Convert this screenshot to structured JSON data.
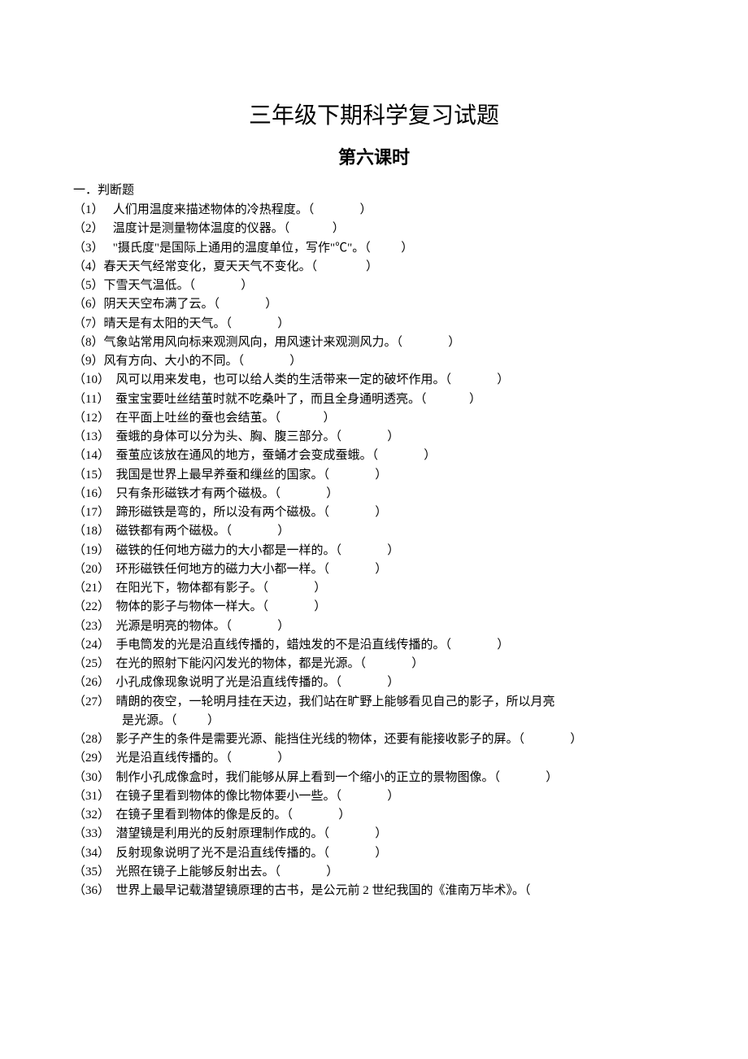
{
  "title": "三年级下期科学复习试题",
  "subtitle": "第六课时",
  "section_header": "一．判断题",
  "items": [
    {
      "num": "（1）",
      "gap": "   ",
      "text": "人们用温度来描述物体的冷热程度。",
      "paren": "（               ）"
    },
    {
      "num": "（2）",
      "gap": "   ",
      "text": "温度计是测量物体温度的仪器。",
      "paren": "（              ）"
    },
    {
      "num": "（3）",
      "gap": "   ",
      "text": "\"摄氏度\"是国际上通用的温度单位，写作\"℃\"。",
      "paren": "（          ）"
    },
    {
      "num": "（4）",
      "gap": "",
      "text": "春天天气经常变化，夏天天气不变化。",
      "paren": "（                ）"
    },
    {
      "num": "（5）",
      "gap": "",
      "text": "下雪天气温低。",
      "paren": "（               ）"
    },
    {
      "num": "（6）",
      "gap": "",
      "text": "阴天天空布满了云。",
      "paren": "（               ）"
    },
    {
      "num": "（7）",
      "gap": "",
      "text": "晴天是有太阳的天气。",
      "paren": "（               ）"
    },
    {
      "num": "（8）",
      "gap": "",
      "text": "气象站常用风向标来观测风向，用风速计来观测风力。",
      "paren": "（               ）"
    },
    {
      "num": "（9）",
      "gap": "",
      "text": "风有方向、大小的不同。",
      "paren": "（               ）"
    },
    {
      "num": "（10）",
      "gap": "  ",
      "text": "风可以用来发电，也可以给人类的生活带来一定的破坏作用。",
      "paren": "（               ）"
    },
    {
      "num": "（11）",
      "gap": "  ",
      "text": "蚕宝宝要吐丝结茧时就不吃桑叶了，而且全身通明透亮。",
      "paren": "（              ）"
    },
    {
      "num": "（12）",
      "gap": "  ",
      "text": "在平面上吐丝的蚕也会结茧。",
      "paren": "（              ）"
    },
    {
      "num": "（13）",
      "gap": "  ",
      "text": "蚕蛾的身体可以分为头、胸、腹三部分。",
      "paren": "（               ）"
    },
    {
      "num": "（14）",
      "gap": "  ",
      "text": "蚕茧应该放在通风的地方，蚕蛹才会变成蚕蛾。",
      "paren": "（               ）"
    },
    {
      "num": "（15）",
      "gap": "  ",
      "text": "我国是世界上最早养蚕和缫丝的国家。",
      "paren": "（               ）"
    },
    {
      "num": "（16）",
      "gap": "  ",
      "text": "只有条形磁铁才有两个磁极。",
      "paren": "（               ）"
    },
    {
      "num": "（17）",
      "gap": "  ",
      "text": "蹄形磁铁是弯的，所以没有两个磁极。",
      "paren": "（               ）"
    },
    {
      "num": "（18）",
      "gap": "  ",
      "text": "磁铁都有两个磁极。",
      "paren": "（               ）"
    },
    {
      "num": "（19）",
      "gap": "  ",
      "text": "磁铁的任何地方磁力的大小都是一样的。",
      "paren": "（               ）"
    },
    {
      "num": "（20）",
      "gap": "  ",
      "text": "环形磁铁任何地方的磁力大小都一样。",
      "paren": "（               ）"
    },
    {
      "num": "（21）",
      "gap": "  ",
      "text": "在阳光下，物体都有影子。",
      "paren": "（               ）"
    },
    {
      "num": "（22）",
      "gap": "  ",
      "text": "物体的影子与物体一样大。",
      "paren": "（               ）"
    },
    {
      "num": "（23）",
      "gap": "  ",
      "text": "光源是明亮的物体。",
      "paren": "（               ）"
    },
    {
      "num": "（24）",
      "gap": "  ",
      "text": "手电筒发的光是沿直线传播的，蜡烛发的不是沿直线传播的。",
      "paren": "（               ）"
    },
    {
      "num": "（25）",
      "gap": "  ",
      "text": "在光的照射下能闪闪发光的物体，都是光源。",
      "paren": "（               ）"
    },
    {
      "num": "（26）",
      "gap": "  ",
      "text": "小孔成像现象说明了光是沿直线传播的。",
      "paren": "（               ）"
    },
    {
      "num": "（27）",
      "gap": "  ",
      "text": "晴朗的夜空，一轮明月挂在天边，我们站在旷野上能够看见自己的影子，所以月亮",
      "cont": "是光源。",
      "paren": "（          ）"
    },
    {
      "num": "（28）",
      "gap": "  ",
      "text": "影子产生的条件是需要光源、能挡住光线的物体，还要有能接收影子的屏。",
      "paren": "（               ）"
    },
    {
      "num": "（29）",
      "gap": "  ",
      "text": "光是沿直线传播的。",
      "paren": "（               ）"
    },
    {
      "num": "（30）",
      "gap": "  ",
      "text": "制作小孔成像盒时，我们能够从屏上看到一个缩小的正立的景物图像。",
      "paren": "（               ）"
    },
    {
      "num": "（31）",
      "gap": "  ",
      "text": "在镜子里看到物体的像比物体要小一些。",
      "paren": "（               ）"
    },
    {
      "num": "（32）",
      "gap": "  ",
      "text": "在镜子里看到物体的像是反的。",
      "paren": "（               ）"
    },
    {
      "num": "（33）",
      "gap": "  ",
      "text": "潜望镜是利用光的反射原理制作成的。",
      "paren": "（               ）"
    },
    {
      "num": "（34）",
      "gap": "  ",
      "text": "反射现象说明了光不是沿直线传播的。",
      "paren": "（               ）"
    },
    {
      "num": "（35）",
      "gap": "  ",
      "text": "光照在镜子上能够反射出去。",
      "paren": "（               ）"
    },
    {
      "num": "（36）",
      "gap": "  ",
      "text": "世界上最早记载潜望镜原理的古书，是公元前 2 世纪我国的《淮南万毕术》。",
      "paren": "（"
    }
  ]
}
